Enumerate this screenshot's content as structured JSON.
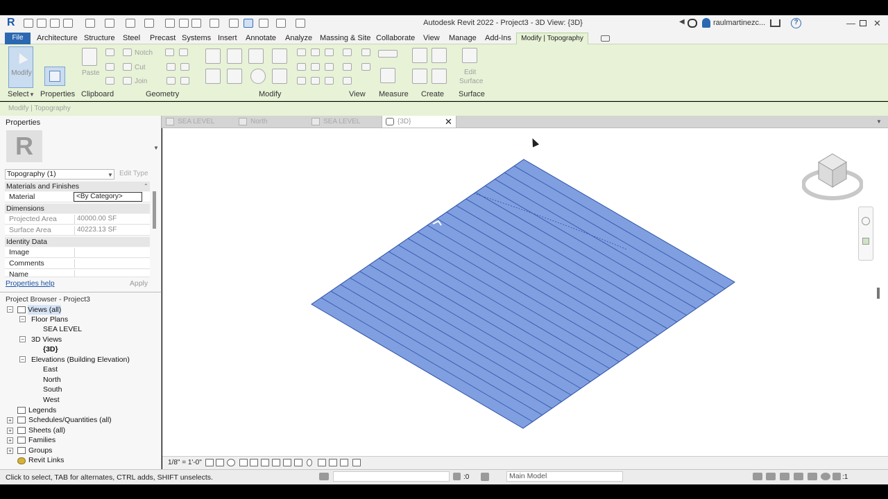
{
  "app": {
    "logo": "R",
    "window_title": "Autodesk Revit 2022 - Project3 - 3D View: {3D}",
    "user": "raulmartinezc...",
    "help_glyph": "?"
  },
  "menu": {
    "file": "File",
    "tabs": [
      "Architecture",
      "Structure",
      "Steel",
      "Precast",
      "Systems",
      "Insert",
      "Annotate",
      "Analyze",
      "Massing & Site",
      "Collaborate",
      "View",
      "Manage",
      "Add-Ins"
    ],
    "active": "Modify | Topography"
  },
  "ribbon": {
    "modify": "Modify",
    "paste": "Paste",
    "notch": "Notch",
    "cut": "Cut",
    "join": "Join",
    "edit_surface": [
      "Edit",
      "Surface"
    ],
    "panels": [
      "Select",
      "Properties",
      "Clipboard",
      "Geometry",
      "Modify",
      "View",
      "Measure",
      "Create",
      "Surface"
    ]
  },
  "options_bar": {
    "text": "Modify | Topography"
  },
  "properties": {
    "header": "Properties",
    "type_icon": "R",
    "type_selector": "Topography (1)",
    "edit_type": "Edit Type",
    "groups": {
      "materials": "Materials and Finishes",
      "dimensions": "Dimensions",
      "identity": "Identity Data"
    },
    "rows": {
      "material": {
        "label": "Material",
        "value": "<By Category>"
      },
      "projected_area": {
        "label": "Projected Area",
        "value": "40000.00 SF"
      },
      "surface_area": {
        "label": "Surface Area",
        "value": "40223.13 SF"
      },
      "image": {
        "label": "Image",
        "value": ""
      },
      "comments": {
        "label": "Comments",
        "value": ""
      },
      "name": {
        "label": "Name",
        "value": ""
      }
    },
    "help": "Properties help",
    "apply": "Apply"
  },
  "project_browser": {
    "header": "Project Browser - Project3",
    "views_all": "Views (all)",
    "floor_plans": "Floor Plans",
    "sea_level": "SEA LEVEL",
    "views_3d": "3D Views",
    "view_3d": "{3D}",
    "elevations": "Elevations (Building Elevation)",
    "east": "East",
    "north": "North",
    "south": "South",
    "west": "West",
    "legends": "Legends",
    "schedules": "Schedules/Quantities (all)",
    "sheets": "Sheets (all)",
    "families": "Families",
    "groups": "Groups",
    "revit_links": "Revit Links"
  },
  "view_tabs": [
    "SEA LEVEL",
    "North",
    "SEA LEVEL",
    "{3D}"
  ],
  "view_close": "✕",
  "view_control": {
    "scale": "1/8\" = 1'-0\""
  },
  "status": {
    "hint": "Click to select, TAB for alternates, CTRL adds, SHIFT unselects.",
    "count": ":0",
    "model": "Main Model",
    "filter_count": ":1"
  },
  "colors": {
    "topo_fill": "#7f9fe0",
    "topo_stroke": "#2c4fa8",
    "ribbon_bg": "#e7f2d7",
    "file_tab": "#2b68b1"
  }
}
